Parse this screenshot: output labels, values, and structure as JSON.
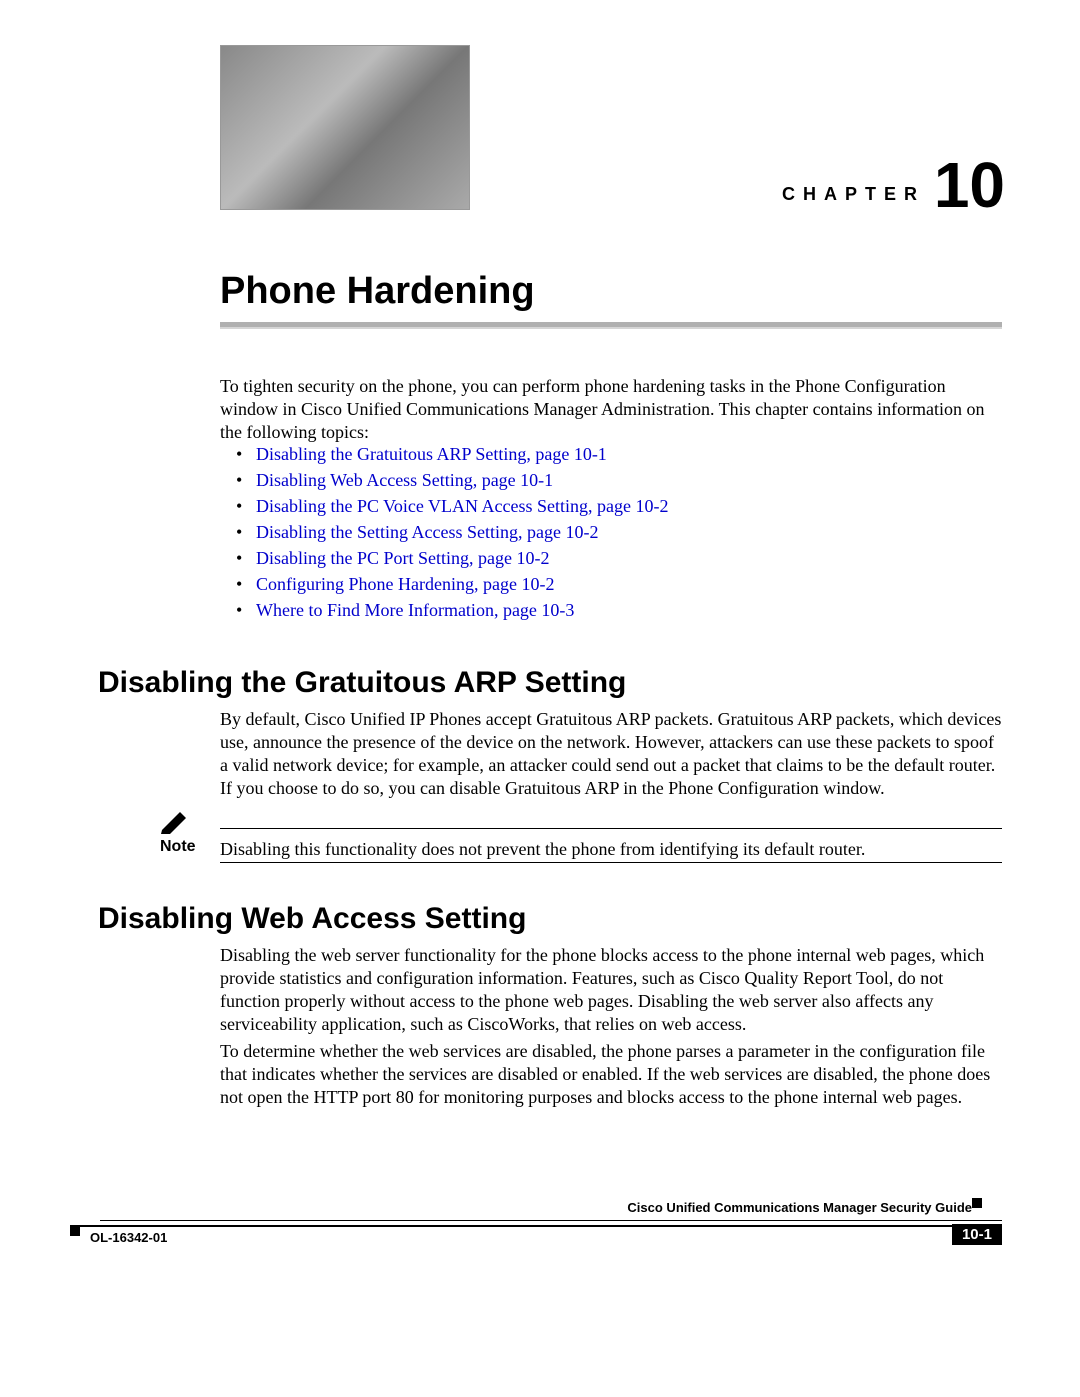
{
  "chapter": {
    "label": "CHAPTER",
    "number": "10",
    "title": "Phone Hardening"
  },
  "intro": "To tighten security on the phone, you can perform phone hardening tasks in the Phone Configuration window in Cisco Unified Communications Manager Administration. This chapter contains information on the following topics:",
  "toc": [
    "Disabling the Gratuitous ARP Setting, page 10-1",
    "Disabling Web Access Setting, page 10-1",
    "Disabling the PC Voice VLAN Access Setting, page 10-2",
    "Disabling the Setting Access Setting, page 10-2",
    "Disabling the PC Port Setting, page 10-2",
    "Configuring Phone Hardening, page 10-2",
    "Where to Find More Information, page 10-3"
  ],
  "section1": {
    "heading": "Disabling the Gratuitous ARP Setting",
    "para": "By default, Cisco Unified IP Phones accept Gratuitous ARP packets. Gratuitous ARP packets, which devices use, announce the presence of the device on the network. However, attackers can use these packets to spoof a valid network device; for example, an attacker could send out a packet that claims to be the default router. If you choose to do so, you can disable Gratuitous ARP in the Phone Configuration window.",
    "note_label": "Note",
    "note_text": "Disabling this functionality does not prevent the phone from identifying its default router."
  },
  "section2": {
    "heading": "Disabling Web Access Setting",
    "para1": "Disabling the web server functionality for the phone blocks access to the phone internal web pages, which provide statistics and configuration information. Features, such as Cisco Quality Report Tool, do not function properly without access to the phone web pages. Disabling the web server also affects any serviceability application, such as CiscoWorks, that relies on web access.",
    "para2": "To determine whether the web services are disabled, the phone parses a parameter in the configuration file that indicates whether the services are disabled or enabled. If the web services are disabled, the phone does not open the HTTP port 80 for monitoring purposes and blocks access to the phone internal web pages."
  },
  "footer": {
    "doc_title": "Cisco Unified Communications Manager Security Guide",
    "doc_id": "OL-16342-01",
    "page_num": "10-1"
  }
}
